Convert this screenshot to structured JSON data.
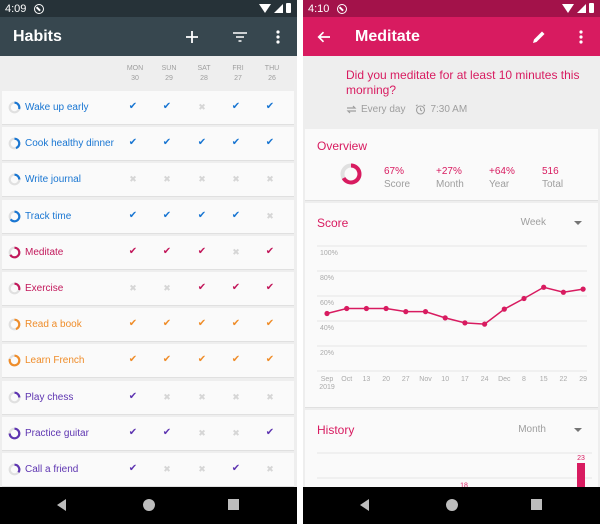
{
  "left": {
    "status_time": "4:09",
    "title": "Habits",
    "actions": [
      "add",
      "filter",
      "more"
    ],
    "days": [
      {
        "dow": "MON",
        "date": "30"
      },
      {
        "dow": "SUN",
        "date": "29"
      },
      {
        "dow": "SAT",
        "date": "28"
      },
      {
        "dow": "FRI",
        "date": "27"
      },
      {
        "dow": "THU",
        "date": "26"
      }
    ],
    "habits": [
      {
        "name": "Wake up early",
        "color": "#1976d2",
        "score": 0.3,
        "marks": [
          1,
          1,
          0,
          1,
          1
        ]
      },
      {
        "name": "Cook healthy dinner",
        "color": "#1976d2",
        "score": 0.45,
        "marks": [
          1,
          1,
          1,
          1,
          1
        ]
      },
      {
        "name": "Write journal",
        "color": "#1976d2",
        "score": 0.25,
        "marks": [
          0,
          0,
          0,
          0,
          0
        ]
      },
      {
        "name": "Track time",
        "color": "#1976d2",
        "score": 0.65,
        "marks": [
          1,
          1,
          1,
          1,
          0
        ]
      },
      {
        "name": "Meditate",
        "color": "#c2185b",
        "score": 0.67,
        "marks": [
          1,
          1,
          1,
          0,
          1
        ]
      },
      {
        "name": "Exercise",
        "color": "#c2185b",
        "score": 0.3,
        "marks": [
          0,
          0,
          1,
          1,
          1
        ]
      },
      {
        "name": "Read a book",
        "color": "#ef8d2a",
        "score": 0.45,
        "marks": [
          1,
          1,
          1,
          1,
          1
        ]
      },
      {
        "name": "Learn French",
        "color": "#ef8d2a",
        "score": 0.8,
        "marks": [
          1,
          1,
          1,
          1,
          1
        ]
      },
      {
        "name": "Play chess",
        "color": "#5e35b1",
        "score": 0.25,
        "marks": [
          1,
          0,
          0,
          0,
          0
        ]
      },
      {
        "name": "Practice guitar",
        "color": "#5e35b1",
        "score": 0.75,
        "marks": [
          1,
          1,
          0,
          0,
          1
        ]
      },
      {
        "name": "Call a friend",
        "color": "#5e35b1",
        "score": 0.35,
        "marks": [
          1,
          0,
          0,
          1,
          0
        ]
      }
    ],
    "check_glyph": "✔",
    "cross_glyph": "✖"
  },
  "right": {
    "status_time": "4:10",
    "title": "Meditate",
    "question": "Did you meditate for at least 10 minutes this morning?",
    "frequency": "Every day",
    "reminder": "7:30 AM",
    "accent": "#d81b60",
    "overview": {
      "title": "Overview",
      "score_fraction": 0.67,
      "stats": [
        {
          "value": "67%",
          "label": "Score"
        },
        {
          "value": "+27%",
          "label": "Month"
        },
        {
          "value": "+64%",
          "label": "Year"
        },
        {
          "value": "516",
          "label": "Total"
        }
      ]
    },
    "score": {
      "title": "Score",
      "period": "Week"
    },
    "history": {
      "title": "History",
      "period": "Month"
    }
  },
  "chart_data": [
    {
      "type": "line",
      "title": "Score",
      "x": [
        "Sep\n2019",
        "Oct",
        "13",
        "20",
        "27",
        "Nov",
        "10",
        "17",
        "24",
        "Dec",
        "8",
        "15",
        "22",
        "29"
      ],
      "x_labels_line1": [
        "Sep",
        "Oct",
        "13",
        "20",
        "27",
        "Nov",
        "10",
        "17",
        "24",
        "Dec",
        "8",
        "15",
        "22",
        "29"
      ],
      "x_labels_line2": [
        "2019",
        "",
        "",
        "",
        "",
        "",
        "",
        "",
        "",
        "",
        "",
        "",
        "",
        ""
      ],
      "values": [
        46,
        50,
        50,
        50,
        47.5,
        47.5,
        42.5,
        38.5,
        37.5,
        49.5,
        58,
        67,
        63,
        65.5
      ],
      "ylim": [
        0,
        100
      ],
      "yticks": [
        "100%",
        "80%",
        "60%",
        "40%",
        "20%"
      ],
      "grid": true,
      "color": "#d81b60"
    },
    {
      "type": "bar",
      "title": "History",
      "visible_values": [
        18,
        23
      ],
      "color": "#d81b60"
    }
  ]
}
